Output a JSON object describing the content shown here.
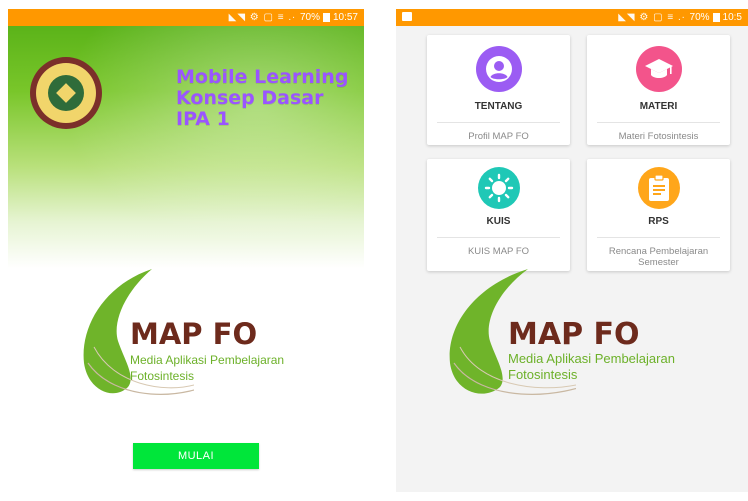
{
  "left": {
    "status_text": "◣◥ ⚙ ▢ ≡ .∙",
    "status_battery": "70%",
    "status_time": "10:57",
    "title_line1": "Mobile Learning",
    "title_line2": "Konsep Dasar",
    "title_line3": "IPA 1",
    "logo_title": "MAP FO",
    "logo_sub1": "Media Aplikasi Pembelajaran",
    "logo_sub2": "Fotosintesis",
    "start_button": "MULAI"
  },
  "right": {
    "status_text": "◣◥ ⚙ ▢ ≡ .∙",
    "status_battery": "70%",
    "status_time": "10:5",
    "cards": [
      {
        "label": "TENTANG",
        "desc": "Profil MAP FO",
        "icon": "user-icon",
        "color": "#9b5cf3"
      },
      {
        "label": "MATERI",
        "desc": "Materi Fotosintesis",
        "icon": "graduation-cap-icon",
        "color": "#f3548b"
      },
      {
        "label": "KUIS",
        "desc": "KUIS MAP FO",
        "icon": "sun-icon",
        "color": "#1fc8b6"
      },
      {
        "label": "RPS",
        "desc": "Rencana Pembelajaran Semester",
        "icon": "clipboard-icon",
        "color": "#ffa61a"
      }
    ],
    "logo_title": "MAP FO",
    "logo_sub1": "Media Aplikasi Pembelajaran",
    "logo_sub2": "Fotosintesis"
  },
  "colors": {
    "status_bar": "#ff9800",
    "title": "#9a55ff",
    "start_button": "#00e63a",
    "logo_text": "#6d2a1c",
    "logo_sub": "#6db12a"
  }
}
